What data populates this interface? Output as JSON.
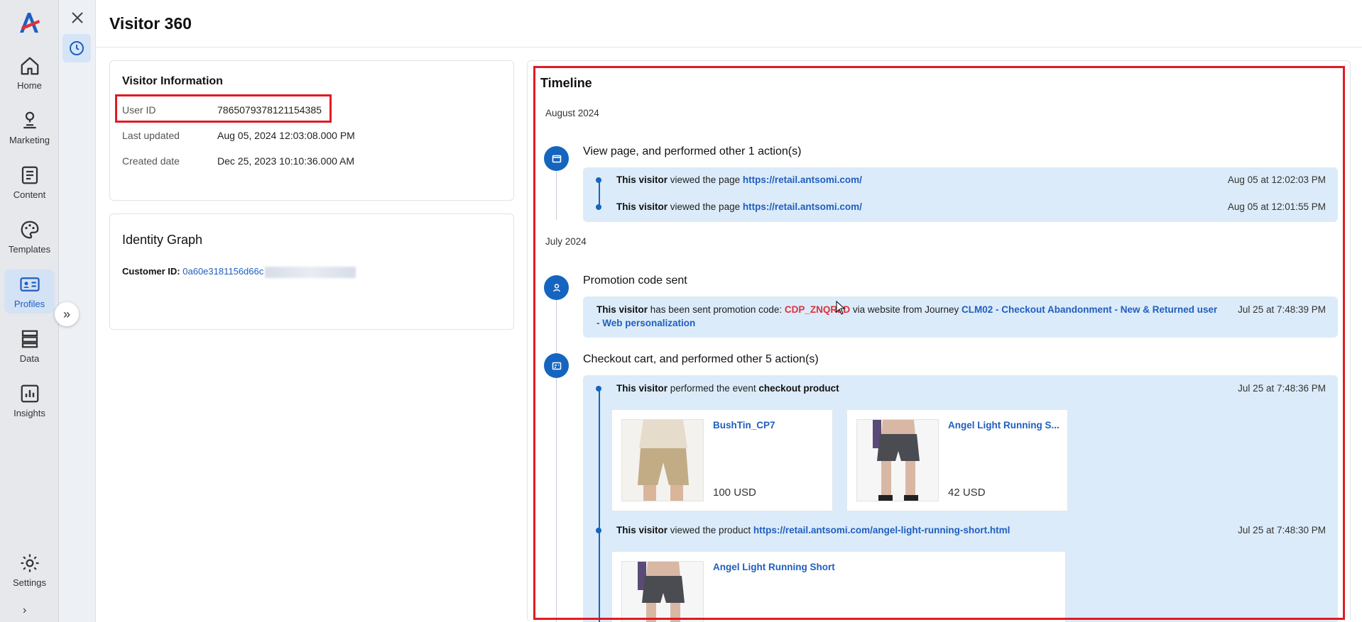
{
  "nav": {
    "items": [
      {
        "label": "Home",
        "icon": "home-icon"
      },
      {
        "label": "Marketing",
        "icon": "marketing-icon"
      },
      {
        "label": "Content",
        "icon": "content-icon"
      },
      {
        "label": "Templates",
        "icon": "palette-icon"
      },
      {
        "label": "Profiles",
        "icon": "profile-card-icon",
        "active": true
      },
      {
        "label": "Data",
        "icon": "data-icon"
      },
      {
        "label": "Insights",
        "icon": "insights-icon"
      }
    ],
    "settings_label": "Settings"
  },
  "header": {
    "title": "Visitor 360"
  },
  "visitor_info": {
    "title": "Visitor Information",
    "rows": [
      {
        "key": "User ID",
        "value": "7865079378121154385"
      },
      {
        "key": "Last updated",
        "value": "Aug 05, 2024 12:03:08.000 PM"
      },
      {
        "key": "Created date",
        "value": "Dec 25, 2023 10:10:36.000 AM"
      }
    ]
  },
  "identity_graph": {
    "title": "Identity Graph",
    "customer_label": "Customer ID:",
    "customer_id": "0a60e3181156d66c"
  },
  "timeline": {
    "title": "Timeline",
    "months": [
      "August 2024",
      "July 2024"
    ],
    "groups": {
      "view_page": {
        "title": "View page, and performed other 1 action(s)",
        "events": [
          {
            "actor": "This visitor",
            "text": " viewed the page ",
            "link": "https://retail.antsomi.com/",
            "time": "Aug 05 at 12:02:03 PM"
          },
          {
            "actor": "This visitor",
            "text": " viewed the page ",
            "link": "https://retail.antsomi.com/",
            "time": "Aug 05 at 12:01:55 PM"
          }
        ]
      },
      "promotion": {
        "title": "Promotion code sent",
        "actor": "This visitor",
        "text1": " has been sent promotion code: ",
        "code": "CDP_ZNQRLD",
        "text2": " via website from Journey ",
        "journey_line1": "CLM02 - Checkout Abandonment - New & Returned user",
        "journey_line2": "- Web personalization",
        "time": "Jul 25 at 7:48:39 PM"
      },
      "checkout": {
        "title": "Checkout cart, and performed other 5 action(s)",
        "event1": {
          "actor": "This visitor",
          "text": " performed the event ",
          "event": "checkout product",
          "time": "Jul 25 at 7:48:36 PM"
        },
        "products": [
          {
            "name": "BushTin_CP7",
            "price": "100 USD"
          },
          {
            "name": "Angel Light Running S...",
            "price": "42 USD"
          }
        ],
        "event2": {
          "actor": "This visitor",
          "text": " viewed the product ",
          "link": "https://retail.antsomi.com/angel-light-running-short.html",
          "time": "Jul 25 at 7:48:30 PM"
        },
        "product3": {
          "name": "Angel Light Running Short"
        }
      }
    }
  },
  "colors": {
    "accent": "#1565c0",
    "highlight": "#e01b24",
    "panel": "#dcebf9",
    "code": "#e0303a"
  }
}
